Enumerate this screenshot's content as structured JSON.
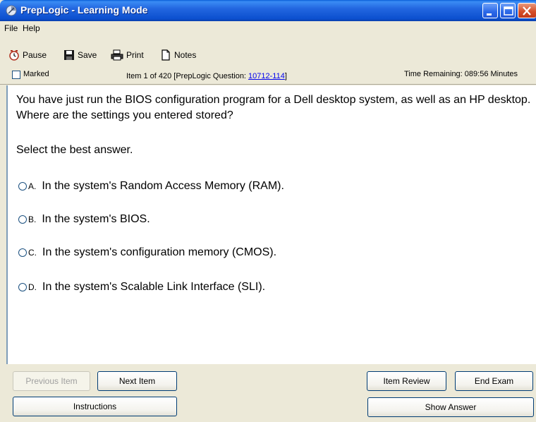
{
  "window": {
    "title": "PrepLogic - Learning Mode"
  },
  "menu": {
    "items": [
      "File",
      "Help"
    ]
  },
  "toolbar": {
    "pause_label": "Pause",
    "save_label": "Save",
    "print_label": "Print",
    "notes_label": "Notes"
  },
  "status": {
    "marked_label": "Marked",
    "item_prefix": "Item 1 of 420  [PrepLogic Question: ",
    "question_id": "10712-114",
    "item_suffix": "]",
    "time_remaining": "Time Remaining: 089:56 Minutes"
  },
  "question": {
    "stem": "You have just run the BIOS configuration program for a Dell desktop system, as well as an HP desktop. Where are the settings you entered stored?",
    "instruction": "Select the best answer.",
    "answers": [
      {
        "letter": "A.",
        "text": "In the system's Random Access Memory (RAM)."
      },
      {
        "letter": "B.",
        "text": "In the system's BIOS."
      },
      {
        "letter": "C.",
        "text": "In the system's configuration memory (CMOS)."
      },
      {
        "letter": "D.",
        "text": "In the system's Scalable Link Interface (SLI)."
      }
    ]
  },
  "buttons": {
    "previous": "Previous Item",
    "next": "Next Item",
    "item_review": "Item Review",
    "end_exam": "End Exam",
    "instructions": "Instructions",
    "show_answer": "Show Answer"
  }
}
